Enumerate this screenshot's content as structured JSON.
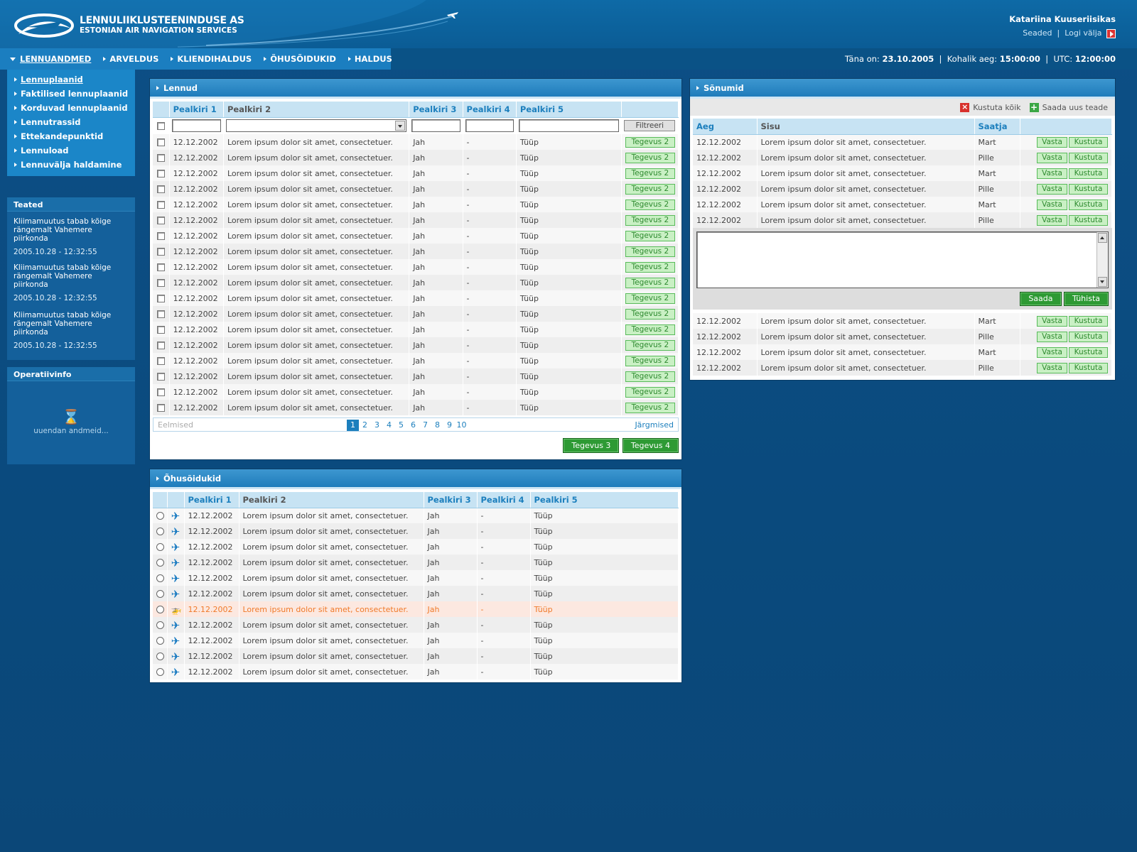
{
  "header": {
    "company_name": "LENNULIIKLUSTEENINDUSE AS",
    "company_subtitle": "ESTONIAN AIR NAVIGATION SERVICES",
    "user_name": "Katariina Kuuseriisikas",
    "settings_link": "Seaded",
    "separator": "|",
    "logout_link": "Logi välja"
  },
  "nav": {
    "items": [
      {
        "label": "LENNUANDMED"
      },
      {
        "label": "ARVELDUS"
      },
      {
        "label": "KLIENDIHALDUS"
      },
      {
        "label": "ÕHUSÕIDUKID"
      },
      {
        "label": "HALDUS"
      }
    ],
    "info": {
      "today_label": "Täna on:",
      "today": "23.10.2005",
      "local_label": "Kohalik aeg:",
      "local": "15:00:00",
      "utc_label": "UTC:",
      "utc": "12:00:00",
      "sep": "|"
    }
  },
  "submenu": {
    "items": [
      {
        "label": "Lennuplaanid"
      },
      {
        "label": "Faktilised lennuplaanid"
      },
      {
        "label": "Korduvad lennuplaanid"
      },
      {
        "label": "Lennutrassid"
      },
      {
        "label": "Ettekandepunktid"
      },
      {
        "label": "Lennuload"
      },
      {
        "label": "Lennuvälja haldamine"
      }
    ]
  },
  "news": {
    "title": "Teated",
    "items": [
      {
        "text": "Kliimamuutus tabab kõige rängemalt Vahemere piirkonda",
        "date": "2005.10.28 - 12:32:55"
      },
      {
        "text": "Kliimamuutus tabab kõige rängemalt Vahemere piirkonda",
        "date": "2005.10.28 - 12:32:55"
      },
      {
        "text": "Kliimamuutus tabab kõige rängemalt Vahemere piirkonda",
        "date": "2005.10.28 - 12:32:55"
      }
    ]
  },
  "operative": {
    "title": "Operatiivinfo",
    "loading": "uuendan andmeid..."
  },
  "flights": {
    "title": "Lennud",
    "headers": [
      "Pealkiri 1",
      "Pealkiri 2",
      "Pealkiri 3",
      "Pealkiri 4",
      "Pealkiri 5"
    ],
    "filter_button": "Filtreeri",
    "row": {
      "c1": "12.12.2002",
      "c2": "Lorem ipsum dolor sit amet, consectetuer.",
      "c3": "Jah",
      "c4": "-",
      "c5": "Tüüp",
      "action": "Tegevus 2"
    },
    "row_count": 18,
    "pager": {
      "prev": "Eelmised",
      "next": "Järgmised",
      "pages": [
        "1",
        "2",
        "3",
        "4",
        "5",
        "6",
        "7",
        "8",
        "9",
        "10"
      ],
      "current": "1"
    },
    "button3": "Tegevus 3",
    "button4": "Tegevus 4"
  },
  "aircraft": {
    "title": "Õhusõidukid",
    "headers": [
      "Pealkiri 1",
      "Pealkiri 2",
      "Pealkiri 3",
      "Pealkiri 4",
      "Pealkiri 5"
    ],
    "row": {
      "c1": "12.12.2002",
      "c2": "Lorem ipsum dolor sit amet, consectetuer.",
      "c3": "Jah",
      "c4": "-",
      "c5": "Tüüp"
    },
    "row_count": 11,
    "highlight_index": 6,
    "icons": {
      "plane": "plane-icon",
      "helicopter": "helicopter-icon"
    }
  },
  "messages": {
    "title": "Sõnumid",
    "delete_all": "Kustuta kõik",
    "send_new": "Saada uus teade",
    "headers": [
      "Aeg",
      "Sisu",
      "Saatja"
    ],
    "rows_top": [
      {
        "time": "12.12.2002",
        "content": "Lorem ipsum dolor sit amet, consectetuer.",
        "sender": "Mart"
      },
      {
        "time": "12.12.2002",
        "content": "Lorem ipsum dolor sit amet, consectetuer.",
        "sender": "Pille"
      },
      {
        "time": "12.12.2002",
        "content": "Lorem ipsum dolor sit amet, consectetuer.",
        "sender": "Mart"
      },
      {
        "time": "12.12.2002",
        "content": "Lorem ipsum dolor sit amet, consectetuer.",
        "sender": "Pille"
      },
      {
        "time": "12.12.2002",
        "content": "Lorem ipsum dolor sit amet, consectetuer.",
        "sender": "Mart"
      },
      {
        "time": "12.12.2002",
        "content": "Lorem ipsum dolor sit amet, consectetuer.",
        "sender": "Pille"
      }
    ],
    "rows_bottom": [
      {
        "time": "12.12.2002",
        "content": "Lorem ipsum dolor sit amet, consectetuer.",
        "sender": "Mart"
      },
      {
        "time": "12.12.2002",
        "content": "Lorem ipsum dolor sit amet, consectetuer.",
        "sender": "Pille"
      },
      {
        "time": "12.12.2002",
        "content": "Lorem ipsum dolor sit amet, consectetuer.",
        "sender": "Mart"
      },
      {
        "time": "12.12.2002",
        "content": "Lorem ipsum dolor sit amet, consectetuer.",
        "sender": "Pille"
      }
    ],
    "reply_label": "Vasta",
    "delete_label": "Kustuta",
    "send_label": "Saada",
    "cancel_label": "Tühista"
  },
  "colors": {
    "background": "#0b4a7d",
    "accent": "#1c7fbd",
    "action_green": "#2e9a34",
    "highlight": "#f07a2a"
  }
}
